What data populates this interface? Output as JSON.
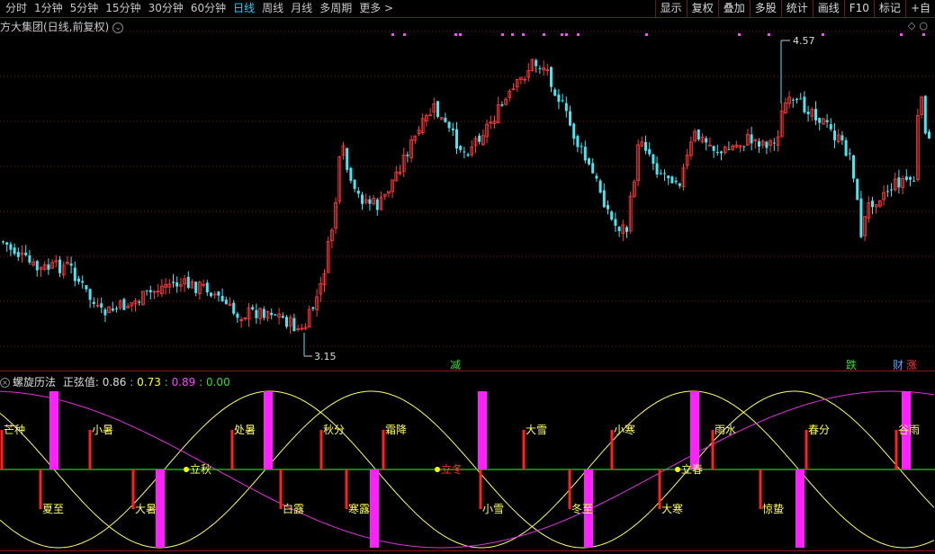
{
  "toolbar": {
    "periods": [
      "分时",
      "1分钟",
      "5分钟",
      "15分钟",
      "30分钟",
      "60分钟",
      "日线",
      "周线",
      "月线",
      "多周期",
      "更多 >"
    ],
    "active_period": "日线",
    "buttons": [
      "显示",
      "复权",
      "叠加",
      "多股",
      "统计",
      "画线",
      "F10",
      "标记",
      "+自"
    ]
  },
  "main_chart": {
    "title": "方大集团(日线,前复权)",
    "high_label": "4.57",
    "low_label": "3.15",
    "markers": [
      {
        "text": "减",
        "color": "#33dd33"
      },
      {
        "text": "跌",
        "color": "#33dd33"
      },
      {
        "text": "财",
        "color": "#5aa0ff"
      },
      {
        "text": "涨",
        "color": "#ff3333"
      }
    ],
    "colors": {
      "up": "#ff3b3b",
      "down": "#4fe3f0",
      "grid": "#7a1a1a",
      "marker_dot": "#ff44ff"
    }
  },
  "indicator": {
    "name": "螺旋历法",
    "value_label": "正弦值:",
    "values": [
      {
        "text": "0.86",
        "color": "#dddddd"
      },
      {
        "text": "0.73",
        "color": "#ffff44"
      },
      {
        "text": "0.89",
        "color": "#ff44ff"
      },
      {
        "text": "0.00",
        "color": "#33dd33"
      }
    ],
    "solar_terms": [
      "芒种",
      "夏至",
      "小暑",
      "大暑",
      "立秋",
      "处暑",
      "白露",
      "秋分",
      "寒露",
      "霜降",
      "立冬",
      "小雪",
      "大雪",
      "冬至",
      "小寒",
      "大寒",
      "立春",
      "雨水",
      "惊蛰",
      "春分",
      "谷雨"
    ],
    "colors": {
      "sine_yellow": "#ffff66",
      "sine_magenta": "#dd33dd",
      "baseline": "#22cc22",
      "bar_red": "#ff2020",
      "bar_magenta": "#ff22ff",
      "label": "#ffff66"
    }
  }
}
